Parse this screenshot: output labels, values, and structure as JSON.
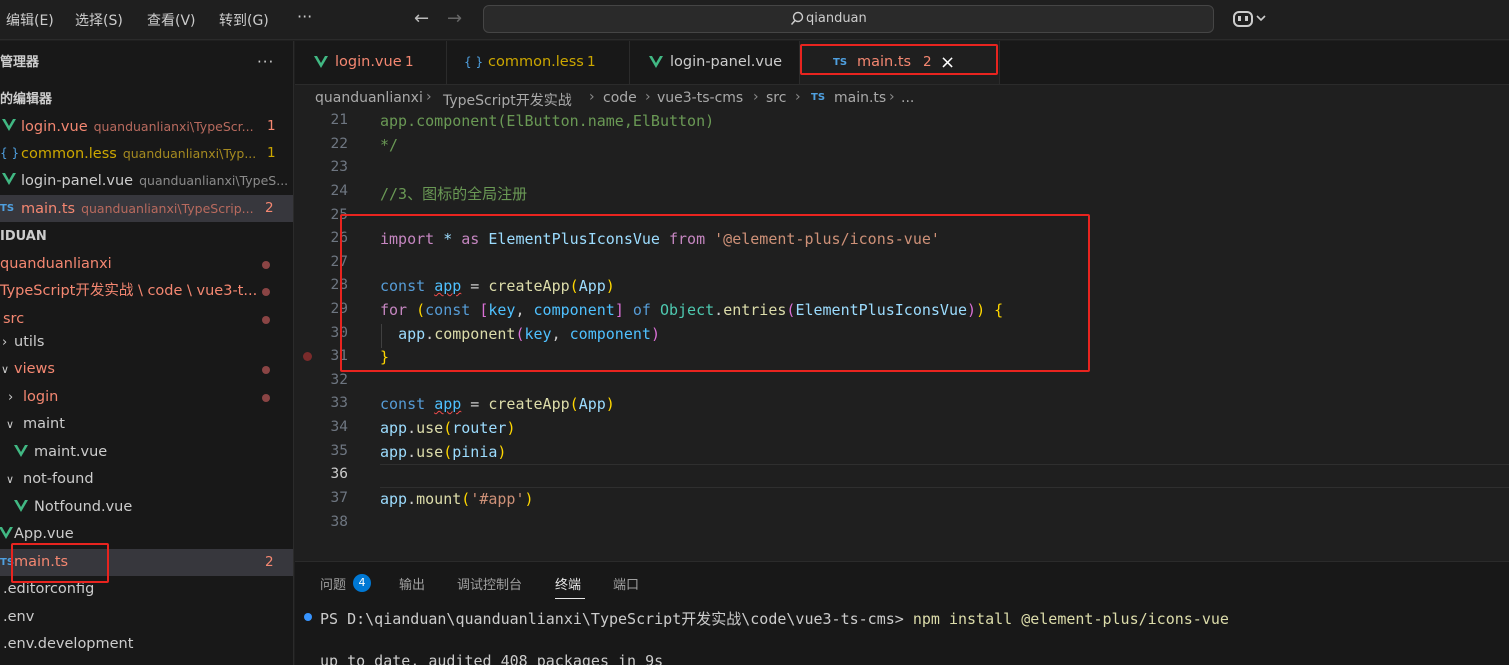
{
  "titlebar": {
    "menus": [
      "编辑(E)",
      "选择(S)",
      "查看(V)",
      "转到(G)"
    ],
    "more": "···",
    "search": "qianduan"
  },
  "sidebar": {
    "explorer_title": "管理器",
    "open_editors_title": "的编辑器",
    "open_editors": [
      {
        "name": "login.vue",
        "desc": "quanduanlianxi\\TypeScr...",
        "badge": "1",
        "icon": "vue-icon"
      },
      {
        "name": "common.less",
        "desc": "quanduanlianxi\\Typ...",
        "badge": "1",
        "icon": "braces-icon"
      },
      {
        "name": "login-panel.vue",
        "desc": "quanduanlianxi\\TypeS...",
        "badge": "",
        "icon": "vue-icon"
      },
      {
        "name": "main.ts",
        "desc": "quanduanlianxi\\TypeScrip...",
        "badge": "2",
        "icon": "ts-icon"
      }
    ],
    "workspace_title": "IDUAN",
    "tree": {
      "root": "quanduanlianxi",
      "path": "TypeScript开发实战 \\ code \\ vue3-t...",
      "src": "src",
      "utils": "utils",
      "views": "views",
      "login": "login",
      "maint": "maint",
      "maint_vue": "maint.vue",
      "not_found": "not-found",
      "notfound_vue": "Notfound.vue",
      "app_vue": "App.vue",
      "main_ts": "main.ts",
      "main_ts_badge": "2",
      "editorconfig": ".editorconfig",
      "env": ".env",
      "env_dev": ".env.development"
    }
  },
  "tabs": [
    {
      "label": "login.vue",
      "count": "1",
      "icon": "vue-icon"
    },
    {
      "label": "common.less",
      "count": "1",
      "icon": "braces-icon"
    },
    {
      "label": "login-panel.vue",
      "count": "",
      "icon": "vue-icon"
    },
    {
      "label": "main.ts",
      "count": "2",
      "icon": "ts-icon",
      "close": "×"
    }
  ],
  "breadcrumb": [
    "quanduanlianxi",
    "TypeScript开发实战",
    "code",
    "vue3-ts-cms",
    "src",
    "main.ts",
    "..."
  ],
  "editor": {
    "line_numbers": [
      "21",
      "22",
      "23",
      "24",
      "25",
      "26",
      "27",
      "28",
      "29",
      "30",
      "31",
      "32",
      "33",
      "34",
      "35",
      "36",
      "37",
      "38"
    ],
    "lines": {
      "l21": "app.component(ElButton.name,ElButton)",
      "l22": "*/",
      "l24": "//3、图标的全局注册",
      "import_kw": "import",
      "star": "*",
      "as_kw": "as",
      "import_name": "ElementPlusIconsVue",
      "from_kw": "from",
      "import_path": "'@element-plus/icons-vue'",
      "const_kw": "const",
      "app_var": "app",
      "eq": " = ",
      "createApp": "createApp",
      "App": "App",
      "for_kw": "for",
      "key": "key",
      "component": "component",
      "of_kw": "of",
      "Object": "Object",
      "entries": "entries",
      "app_component": "component",
      "use": "use",
      "router": "router",
      "pinia": "pinia",
      "mount": "mount",
      "mount_arg": "'#app'"
    }
  },
  "panel": {
    "tabs": [
      "问题",
      "输出",
      "调试控制台",
      "终端",
      "端口"
    ],
    "problem_count": "4",
    "terminal_line1": "PS D:\\qianduan\\quanduanlianxi\\TypeScript开发实战\\code\\vue3-ts-cms> ",
    "terminal_cmd": "npm install @element-plus/icons-vue",
    "terminal_line2": "up to date, audited 408 packages in 9s"
  },
  "colors": {
    "annotation_red": "#e8241f",
    "vue_green": "#41b883",
    "ts_blue": "#4fa0e0",
    "error_red": "#f48771",
    "warning_yellow": "#cca700"
  }
}
